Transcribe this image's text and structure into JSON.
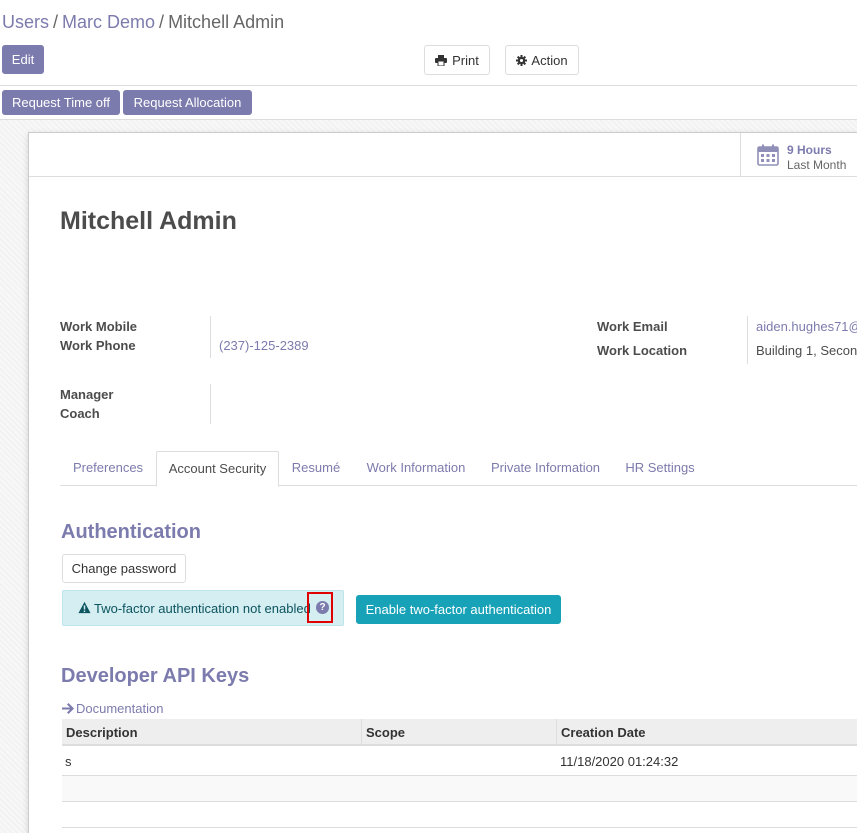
{
  "breadcrumb": {
    "items": [
      "Users",
      "Marc Demo",
      "Mitchell Admin"
    ],
    "separator": "/"
  },
  "control_panel": {
    "edit_label": "Edit",
    "print_label": "Print",
    "action_label": "Action"
  },
  "header_buttons": {
    "request_time_off": "Request Time off",
    "request_allocation": "Request Allocation"
  },
  "stat_button": {
    "value": "9 Hours",
    "caption": "Last Month",
    "icon": "calendar-icon"
  },
  "employee": {
    "name": "Mitchell Admin",
    "work_mobile_label": "Work Mobile",
    "work_phone_label": "Work Phone",
    "work_phone": "(237)-125-2389",
    "manager_label": "Manager",
    "coach_label": "Coach",
    "work_email_label": "Work Email",
    "work_email": "aiden.hughes71@",
    "work_location_label": "Work Location",
    "work_location": "Building 1, Secon"
  },
  "tabs": [
    {
      "label": "Preferences",
      "active": false
    },
    {
      "label": "Account Security",
      "active": true
    },
    {
      "label": "Resumé",
      "active": false
    },
    {
      "label": "Work Information",
      "active": false
    },
    {
      "label": "Private Information",
      "active": false
    },
    {
      "label": "HR Settings",
      "active": false
    }
  ],
  "authentication": {
    "heading": "Authentication",
    "change_password_label": "Change password",
    "alert_text": "Two-factor authentication not enabled",
    "help_icon": "question-circle-icon",
    "enable_2fa_label": "Enable two-factor authentication"
  },
  "api_keys": {
    "heading": "Developer API Keys",
    "documentation_label": "Documentation",
    "columns": [
      "Description",
      "Scope",
      "Creation Date"
    ],
    "rows": [
      {
        "description": "s",
        "scope": "",
        "creation_date": "11/18/2020 01:24:32"
      }
    ]
  },
  "colors": {
    "brand": "#7c7bad",
    "info": "#17a2b8",
    "alert_bg": "#d4eef1",
    "highlight": "#e00000"
  }
}
